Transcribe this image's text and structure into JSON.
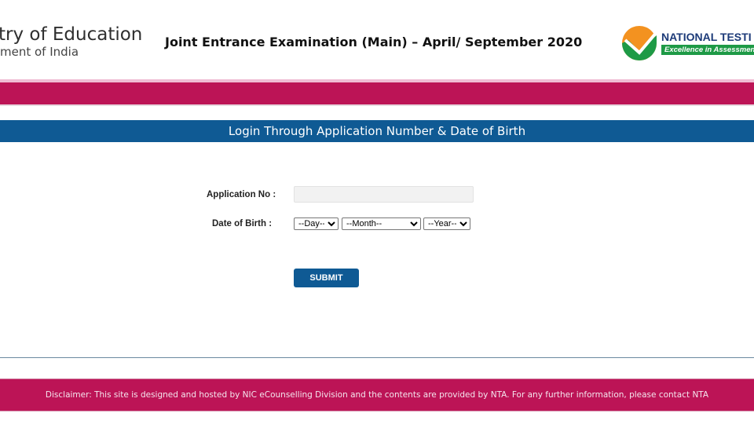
{
  "header": {
    "ministry_line1": "try of Education",
    "ministry_line2": "ment of India",
    "exam_title": "Joint Entrance Examination (Main) – April/ September 2020",
    "logo_text": "NATIONAL TESTI",
    "logo_tagline": "Excellence in Assessment"
  },
  "login": {
    "title": "Login Through Application Number & Date of Birth",
    "application_label": "Application No :",
    "application_value": "",
    "dob_label": "Date of Birth :",
    "day_selected": "--Day--",
    "month_selected": "--Month--",
    "year_selected": "--Year--",
    "submit_label": "SUBMIT"
  },
  "footer": {
    "disclaimer": "Disclaimer: This site is designed and hosted by NIC eCounselling Division and the contents are provided by NTA. For any further information, please contact NTA"
  },
  "colors": {
    "magenta": "#bc1456",
    "blue": "#0f5a94",
    "logo_orange": "#f39220",
    "logo_green": "#1e9a46"
  }
}
